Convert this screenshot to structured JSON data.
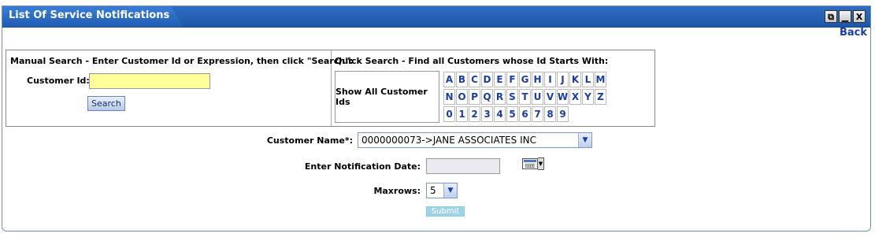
{
  "window": {
    "title": "List Of Service Notifications",
    "buttons": {
      "restore": "⧉",
      "minimize": "▁",
      "close": "X"
    }
  },
  "back_label": "Back",
  "manual_search": {
    "heading": "Manual Search - Enter Customer Id or Expression, then click \"Search\":",
    "customer_id_label": "Customer Id:",
    "customer_id_value": "",
    "search_button": "Search"
  },
  "quick_search": {
    "heading": "Quick Search - Find all Customers whose Id Starts With:",
    "show_all_label": "Show All Customer Ids",
    "rows": [
      [
        "A",
        "B",
        "C",
        "D",
        "E",
        "F",
        "G",
        "H",
        "I",
        "J",
        "K",
        "L",
        "M"
      ],
      [
        "N",
        "O",
        "P",
        "Q",
        "R",
        "S",
        "T",
        "U",
        "V",
        "W",
        "X",
        "Y",
        "Z"
      ],
      [
        "0",
        "1",
        "2",
        "3",
        "4",
        "5",
        "6",
        "7",
        "8",
        "9"
      ]
    ]
  },
  "form": {
    "customer_name_label": "Customer Name*:",
    "customer_name_value": "0000000073->JANE ASSOCIATES INC",
    "notification_date_label": "Enter Notification Date:",
    "notification_date_value": "",
    "maxrows_label": "Maxrows:",
    "maxrows_value": "5",
    "submit_label": "Submit"
  },
  "colors": {
    "titlebar": "#1d56a8",
    "link": "#1a3ea3",
    "customer_id_bg": "#ffff99",
    "submit_bg": "#9ed3e6"
  }
}
